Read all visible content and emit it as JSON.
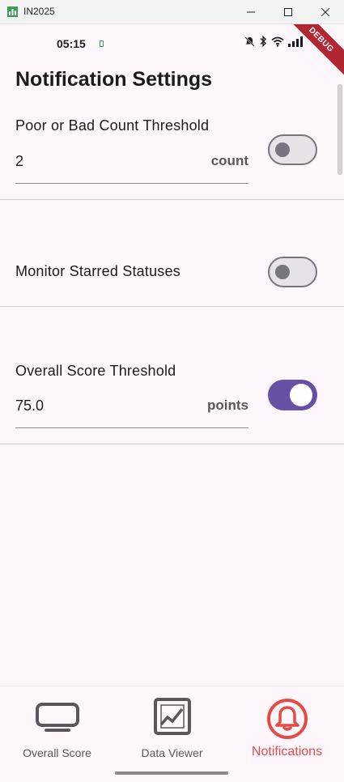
{
  "window": {
    "title": "IN2025"
  },
  "status_bar": {
    "time": "05:15"
  },
  "debug_banner": "DEBUG",
  "page": {
    "title": "Notification Settings"
  },
  "settings": [
    {
      "label": "Poor or Bad Count Threshold",
      "value": "2",
      "suffix": "count",
      "enabled": false
    },
    {
      "label": "Monitor Starred Statuses",
      "enabled": false
    },
    {
      "label": "Overall Score Threshold",
      "value": "75.0",
      "suffix": "points",
      "enabled": true
    }
  ],
  "bottom_nav": {
    "items": [
      {
        "label": "Overall Score",
        "icon": "monitor-icon",
        "active": false
      },
      {
        "label": "Data Viewer",
        "icon": "chart-icon",
        "active": false
      },
      {
        "label": "Notifications",
        "icon": "bell-icon",
        "active": true
      }
    ]
  },
  "colors": {
    "accent": "#6550a5",
    "active_nav": "#e44b46",
    "background": "#fdf7fc"
  }
}
